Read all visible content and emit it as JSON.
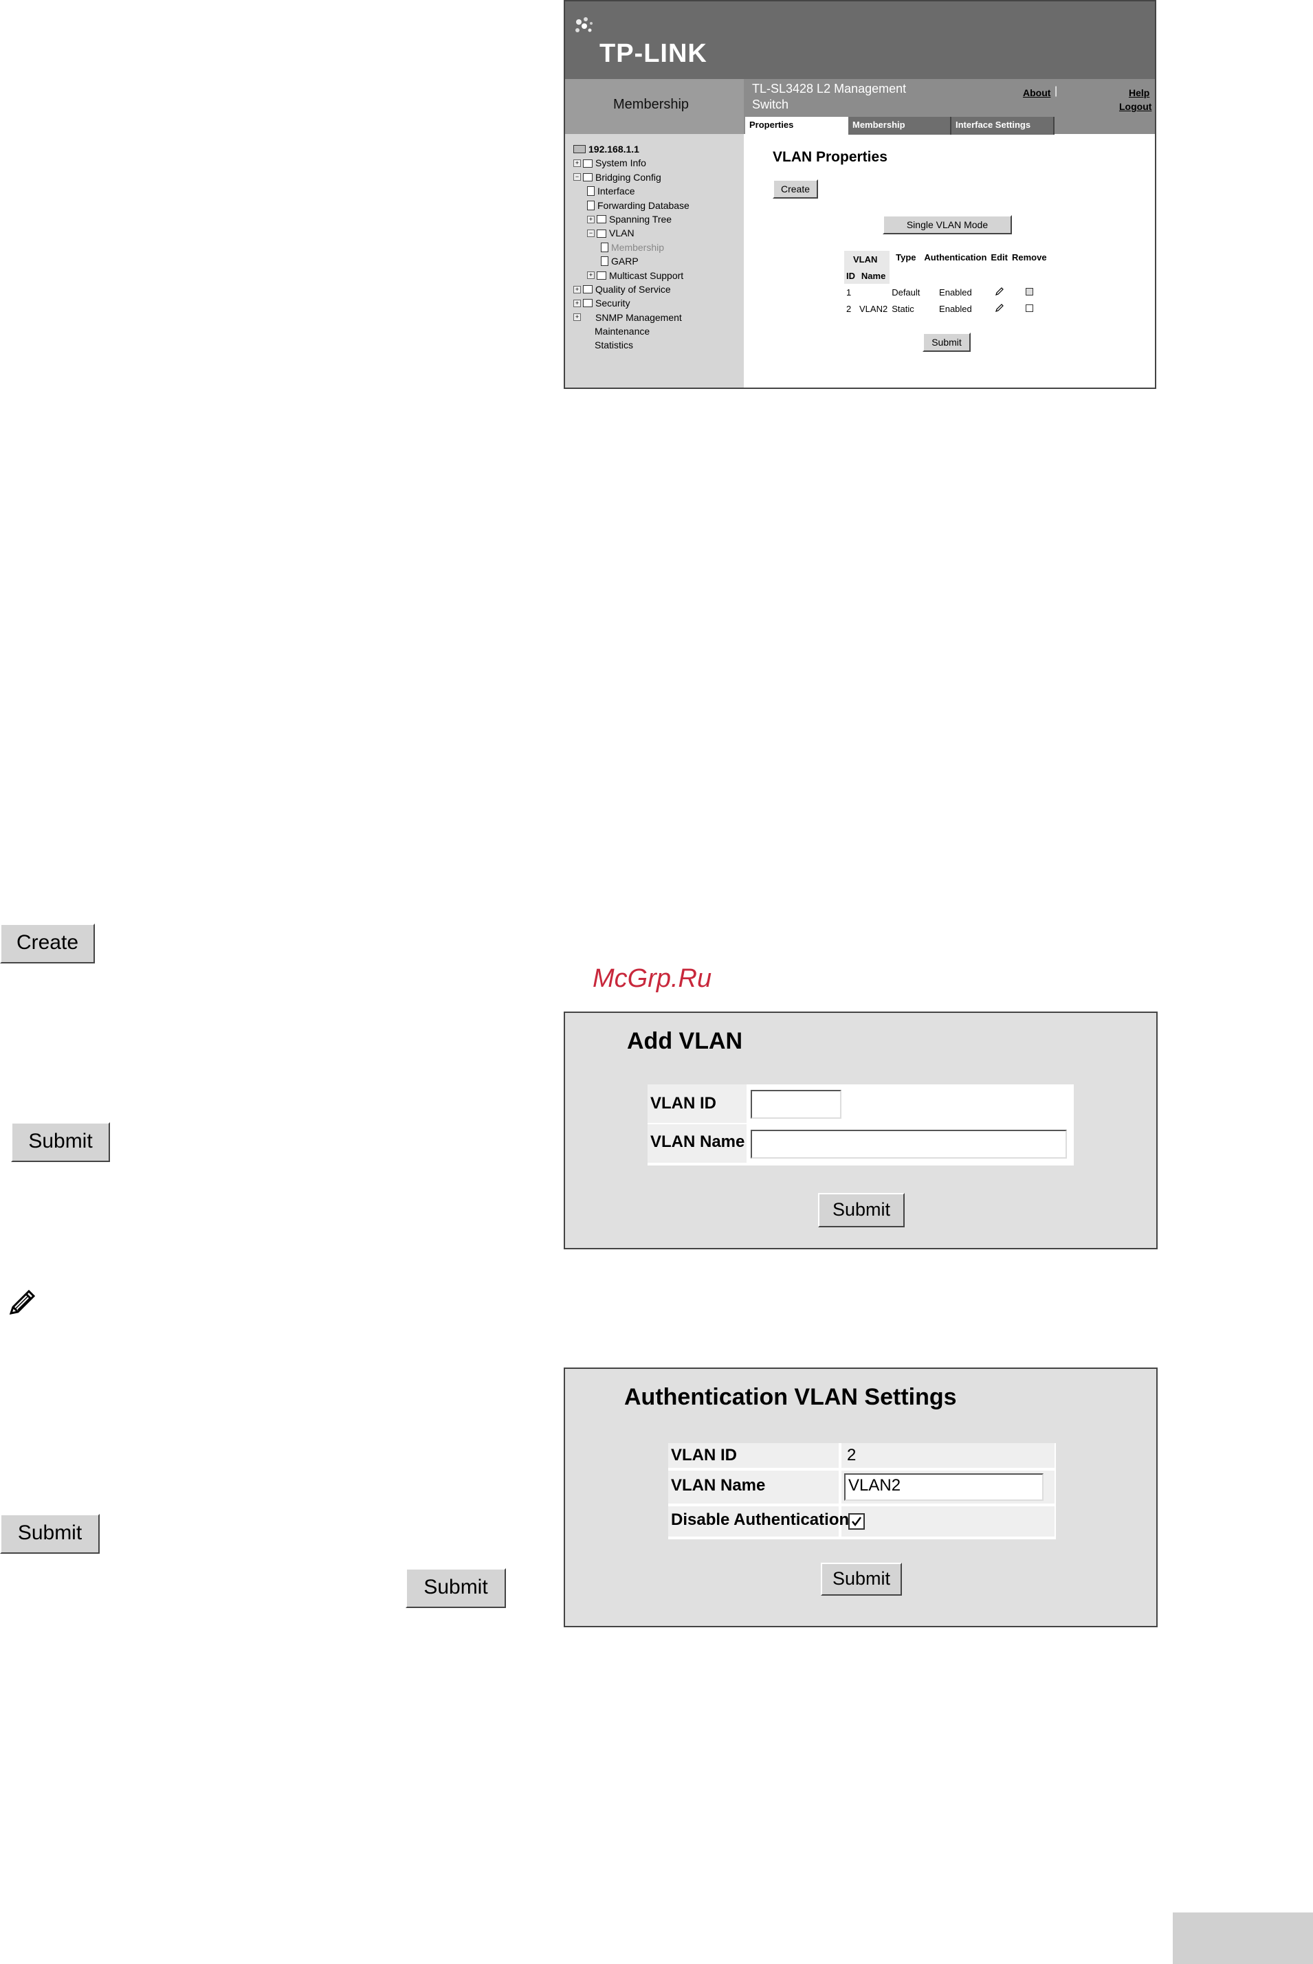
{
  "screenshot1": {
    "brand": "TP-LINK",
    "section_heading": "Membership",
    "device_title": "TL-SL3428 L2 Management Switch",
    "links": {
      "about": "About",
      "help": "Help",
      "logout": "Logout"
    },
    "tabs": [
      "Properties",
      "Membership",
      "Interface Settings"
    ],
    "tree": {
      "root": "192.168.1.1",
      "items": [
        "System Info",
        "Bridging Config",
        "Interface",
        "Forwarding Database",
        "Spanning Tree",
        "VLAN",
        "Membership",
        "GARP",
        "Multicast Support",
        "Quality of Service",
        "Security",
        "SNMP Management",
        "Maintenance",
        "Statistics"
      ]
    },
    "page_title": "VLAN Properties",
    "create_label": "Create",
    "mode_label": "Single VLAN Mode",
    "table": {
      "headers": {
        "vlan_id_top": "VLAN",
        "vlan_id_bottom": "ID",
        "name_bottom": "Name",
        "type": "Type",
        "auth": "Authentication",
        "edit": "Edit",
        "remove": "Remove"
      },
      "rows": [
        {
          "id": "1",
          "name": "",
          "type": "Default",
          "auth": "Enabled"
        },
        {
          "id": "2",
          "name": "VLAN2",
          "type": "Static",
          "auth": "Enabled"
        }
      ]
    },
    "submit_label": "Submit"
  },
  "standalone": {
    "create_label": "Create",
    "submit1_label": "Submit",
    "submit2_label": "Submit",
    "submit3_label": "Submit"
  },
  "watermark": "McGrp.Ru",
  "add_vlan": {
    "title": "Add VLAN",
    "vlan_id_label": "VLAN ID",
    "vlan_name_label": "VLAN Name",
    "vlan_id_value": "",
    "vlan_name_value": "",
    "submit_label": "Submit"
  },
  "auth_vlan": {
    "title": "Authentication VLAN Settings",
    "vlan_id_label": "VLAN ID",
    "vlan_id_value": "2",
    "vlan_name_label": "VLAN Name",
    "vlan_name_value": "VLAN2",
    "disable_auth_label": "Disable Authentication",
    "disable_auth_checked": true,
    "submit_label": "Submit"
  }
}
